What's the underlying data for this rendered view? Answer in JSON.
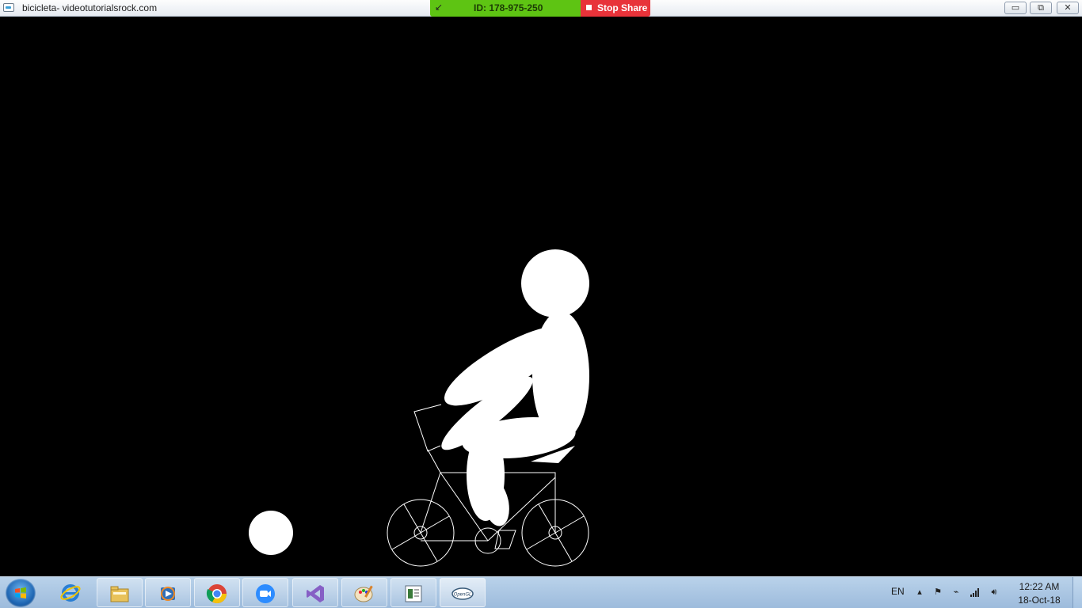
{
  "window": {
    "title": "bicicleta- videotutorialsrock.com"
  },
  "share_bar": {
    "id_text": "ID: 178-975-250",
    "stop_label": "Stop Share"
  },
  "title_buttons": {
    "minimize": "▭",
    "restore": "⧉",
    "close": "✕"
  },
  "taskbar": {
    "apps": [
      {
        "name": "internet-explorer"
      },
      {
        "name": "file-explorer"
      },
      {
        "name": "media-player"
      },
      {
        "name": "chrome"
      },
      {
        "name": "zoom"
      },
      {
        "name": "visual-studio"
      },
      {
        "name": "paint"
      },
      {
        "name": "notepad"
      },
      {
        "name": "opengl-app",
        "label": "OpenGL"
      }
    ],
    "tray": {
      "language": "EN",
      "time": "12:22 AM",
      "date": "18-Oct-18"
    }
  },
  "colors": {
    "scene_bg": "#000000",
    "figure": "#ffffff",
    "share_green": "#5ec413",
    "stop_red": "#e8333a"
  }
}
